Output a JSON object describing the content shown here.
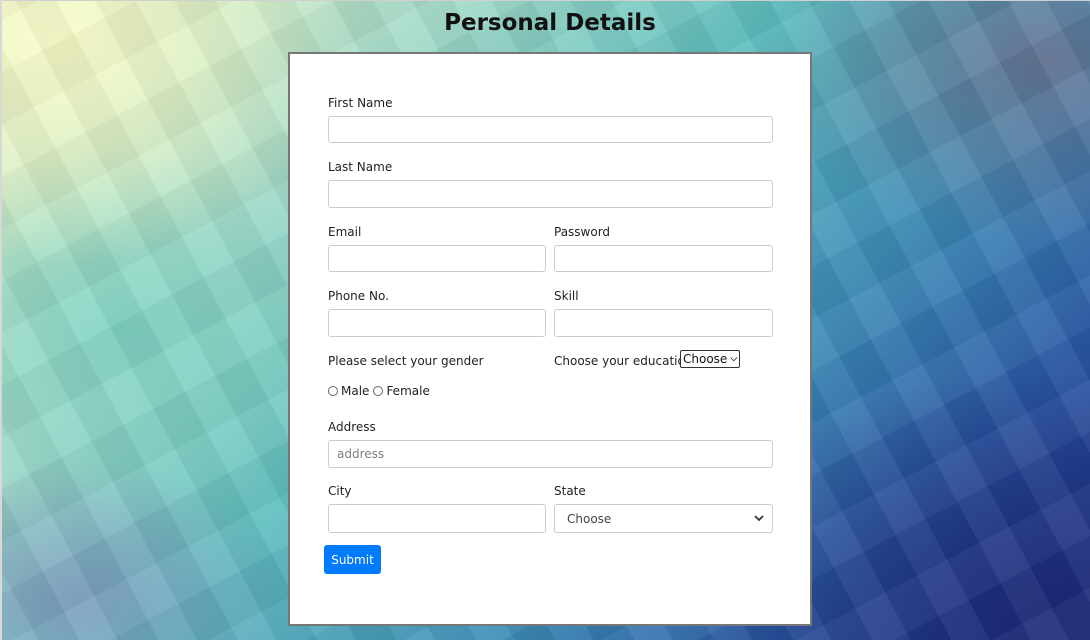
{
  "page": {
    "title": "Personal Details"
  },
  "form": {
    "first_name": {
      "label": "First Name",
      "value": ""
    },
    "last_name": {
      "label": "Last Name",
      "value": ""
    },
    "email": {
      "label": "Email",
      "value": ""
    },
    "password": {
      "label": "Password",
      "value": ""
    },
    "phone": {
      "label": "Phone No.",
      "value": ""
    },
    "skill": {
      "label": "Skill",
      "value": ""
    },
    "gender": {
      "label": "Please select your gender",
      "options": [
        "Male",
        "Female"
      ]
    },
    "education": {
      "label": "Choose your education",
      "selected": "Choose"
    },
    "address": {
      "label": "Address",
      "placeholder": "address",
      "value": ""
    },
    "city": {
      "label": "City",
      "value": ""
    },
    "state": {
      "label": "State",
      "selected": "Choose"
    },
    "submit_label": "Submit"
  },
  "colors": {
    "submit_button": "#007bff",
    "card_border": "#777777",
    "input_border": "#c8ccd0"
  },
  "icons": {
    "education_dropdown": "chevron-down-icon",
    "state_dropdown": "chevron-down-icon"
  }
}
